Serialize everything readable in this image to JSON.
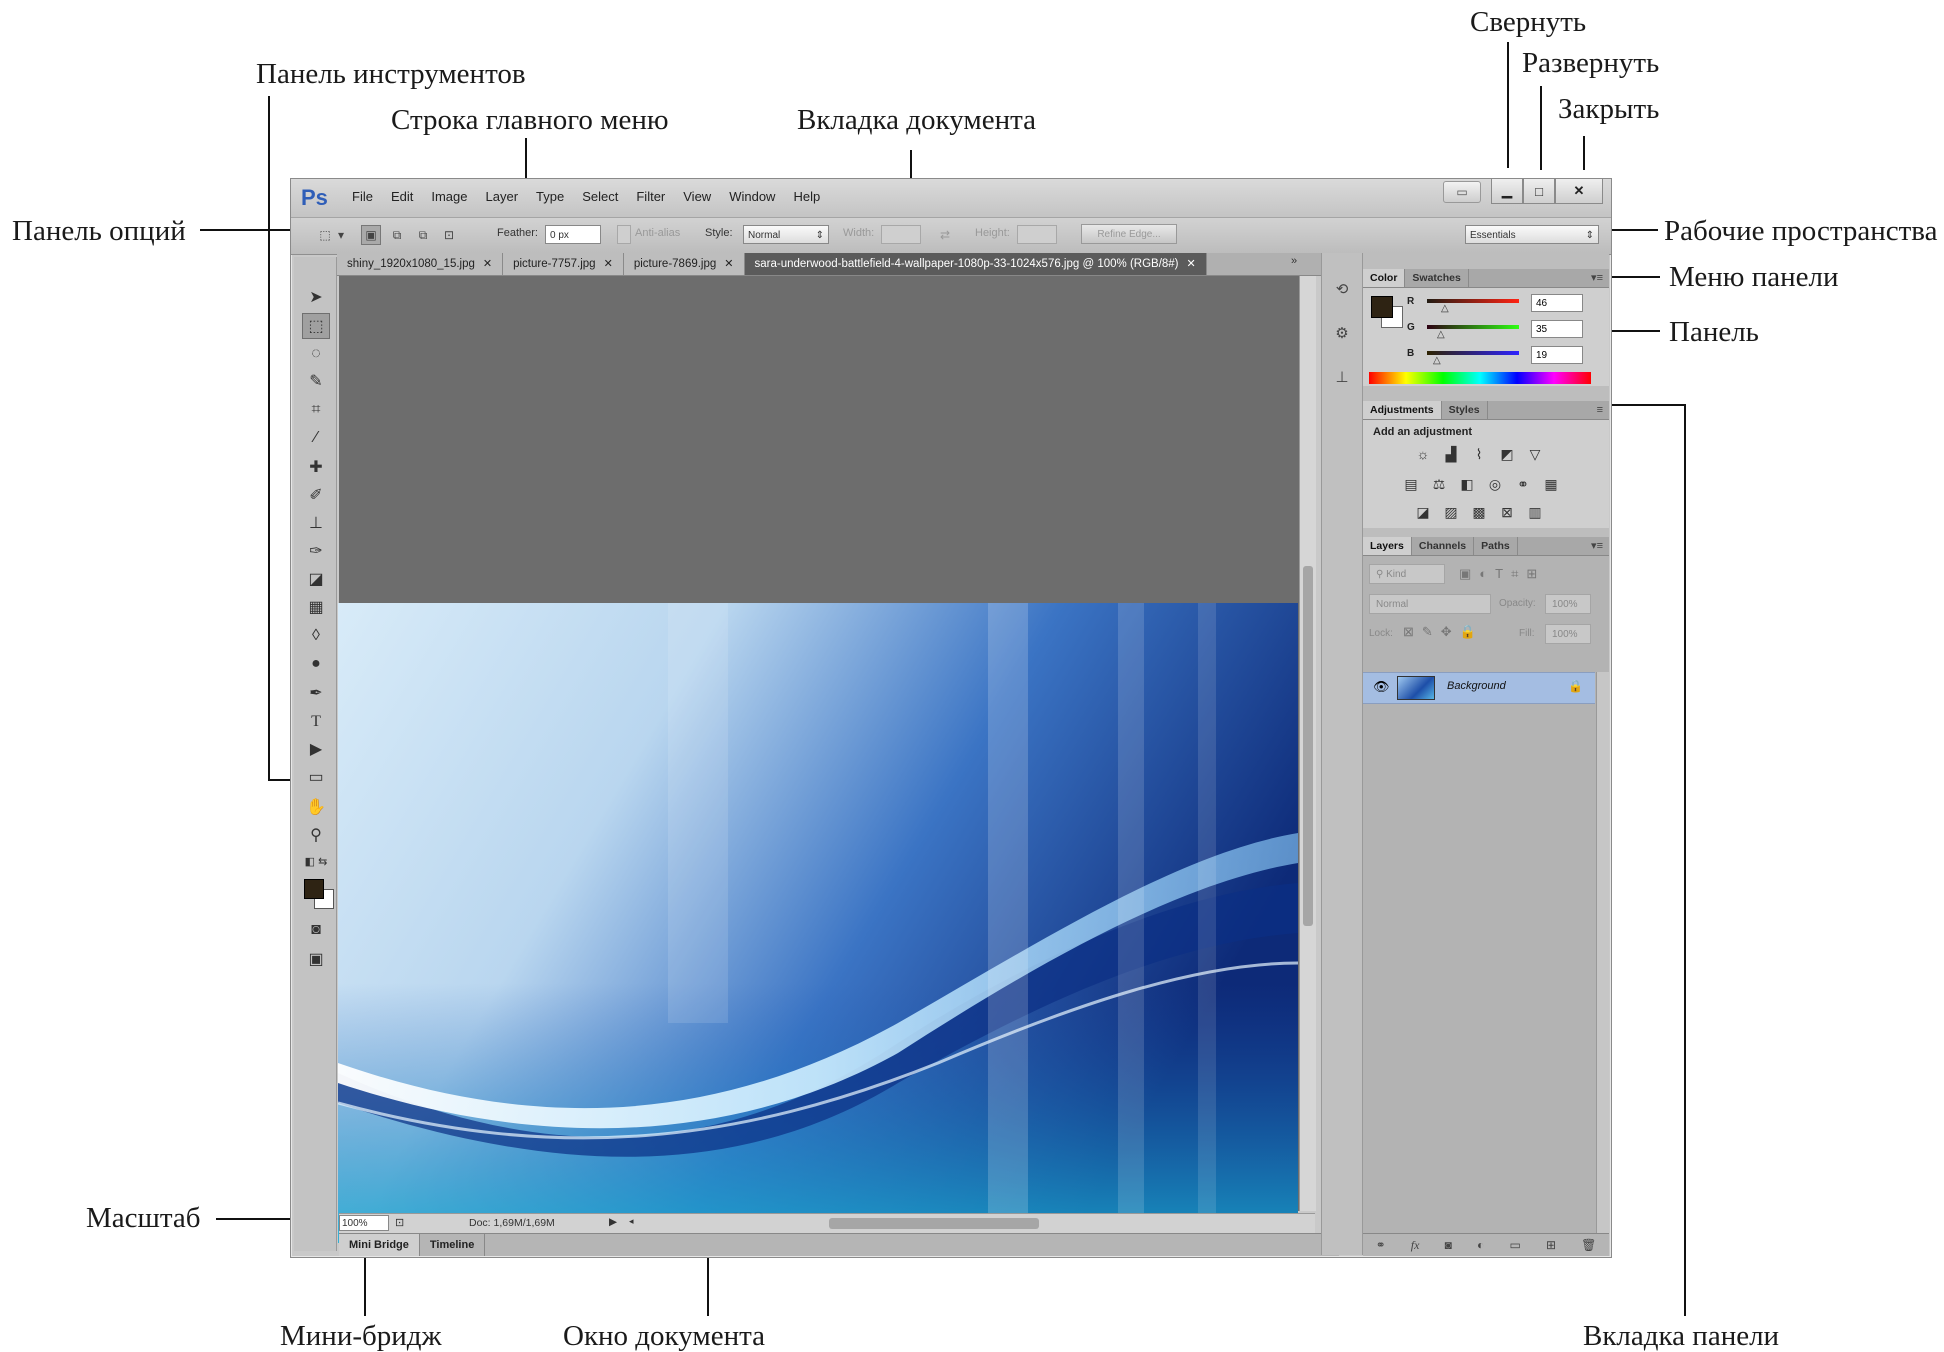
{
  "annotations": {
    "tools_panel": "Панель инструментов",
    "main_menu": "Строка главного меню",
    "document_tab": "Вкладка документа",
    "minimize": "Свернуть",
    "maximize": "Развернуть",
    "close": "Закрыть",
    "options_panel": "Панель опций",
    "workspaces": "Рабочие пространства",
    "panel_menu": "Меню панели",
    "panel": "Панель",
    "zoom": "Масштаб",
    "mini_bridge": "Мини-бридж",
    "document_window": "Окно документа",
    "panel_tab": "Вкладка панели"
  },
  "app": {
    "logo": "Ps",
    "menu": [
      "File",
      "Edit",
      "Image",
      "Layer",
      "Type",
      "Select",
      "Filter",
      "View",
      "Window",
      "Help"
    ]
  },
  "options_bar": {
    "feather_label": "Feather:",
    "feather_value": "0 px",
    "antialias_label": "Anti-alias",
    "style_label": "Style:",
    "style_value": "Normal",
    "width_label": "Width:",
    "height_label": "Height:",
    "refine_edge": "Refine Edge...",
    "workspace": "Essentials"
  },
  "document_tabs": [
    "shiny_1920x1080_15.jpg",
    "picture-7757.jpg",
    "picture-7869.jpg",
    "sara-underwood-battlefield-4-wallpaper-1080p-33-1024x576.jpg @ 100% (RGB/8#)"
  ],
  "status_bar": {
    "zoom": "100%",
    "doc_size": "Doc: 1,69M/1,69M"
  },
  "bottom_tabs": [
    "Mini Bridge",
    "Timeline"
  ],
  "color_panel": {
    "tabs": [
      "Color",
      "Swatches"
    ],
    "channels": [
      {
        "label": "R",
        "value": "46"
      },
      {
        "label": "G",
        "value": "35"
      },
      {
        "label": "B",
        "value": "19"
      }
    ],
    "foreground_color": "#2e2313"
  },
  "adjustments_panel": {
    "tabs": [
      "Adjustments",
      "Styles"
    ],
    "title": "Add an adjustment"
  },
  "layers_panel": {
    "tabs": [
      "Layers",
      "Channels",
      "Paths"
    ],
    "kind_label": "Kind",
    "blend_mode": "Normal",
    "opacity_label": "Opacity:",
    "opacity_value": "100%",
    "lock_label": "Lock:",
    "fill_label": "Fill:",
    "fill_value": "100%",
    "layer_name": "Background"
  }
}
